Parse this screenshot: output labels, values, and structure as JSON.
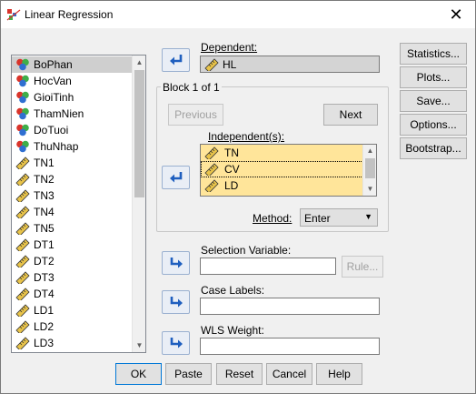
{
  "window": {
    "title": "Linear Regression",
    "close_glyph": "✕"
  },
  "variables": [
    {
      "name": "BoPhan",
      "type": "nominal",
      "selected": true
    },
    {
      "name": "HocVan",
      "type": "nominal"
    },
    {
      "name": "GioiTinh",
      "type": "nominal"
    },
    {
      "name": "ThamNien",
      "type": "nominal"
    },
    {
      "name": "DoTuoi",
      "type": "nominal"
    },
    {
      "name": "ThuNhap",
      "type": "nominal"
    },
    {
      "name": "TN1",
      "type": "scale"
    },
    {
      "name": "TN2",
      "type": "scale"
    },
    {
      "name": "TN3",
      "type": "scale"
    },
    {
      "name": "TN4",
      "type": "scale"
    },
    {
      "name": "TN5",
      "type": "scale"
    },
    {
      "name": "DT1",
      "type": "scale"
    },
    {
      "name": "DT2",
      "type": "scale"
    },
    {
      "name": "DT3",
      "type": "scale"
    },
    {
      "name": "DT4",
      "type": "scale"
    },
    {
      "name": "LD1",
      "type": "scale"
    },
    {
      "name": "LD2",
      "type": "scale"
    },
    {
      "name": "LD3",
      "type": "scale"
    }
  ],
  "dependent": {
    "label": "Dependent:",
    "value": "HL"
  },
  "block": {
    "title": "Block 1 of 1",
    "previous_label": "Previous",
    "next_label": "Next"
  },
  "independents": {
    "label": "Independent(s):",
    "items": [
      "TN",
      "CV",
      "LD"
    ]
  },
  "method": {
    "label": "Method:",
    "value": "Enter"
  },
  "selection_variable": {
    "label": "Selection Variable:",
    "value": "",
    "rule_label": "Rule..."
  },
  "case_labels": {
    "label": "Case Labels:",
    "value": ""
  },
  "wls_weight": {
    "label": "WLS Weight:",
    "value": ""
  },
  "side_buttons": [
    "Statistics...",
    "Plots...",
    "Save...",
    "Options...",
    "Bootstrap..."
  ],
  "bottom_buttons": [
    "OK",
    "Paste",
    "Reset",
    "Cancel",
    "Help"
  ],
  "colors": {
    "selected_row": "#cfcfcf",
    "independents_bg": "#ffe59a",
    "arrow_blue": "#1f5fbf",
    "nominal_red": "#d9342b",
    "nominal_green": "#3fae49",
    "nominal_blue": "#2f6fd1",
    "scale_ruler": "#e8c34a"
  }
}
